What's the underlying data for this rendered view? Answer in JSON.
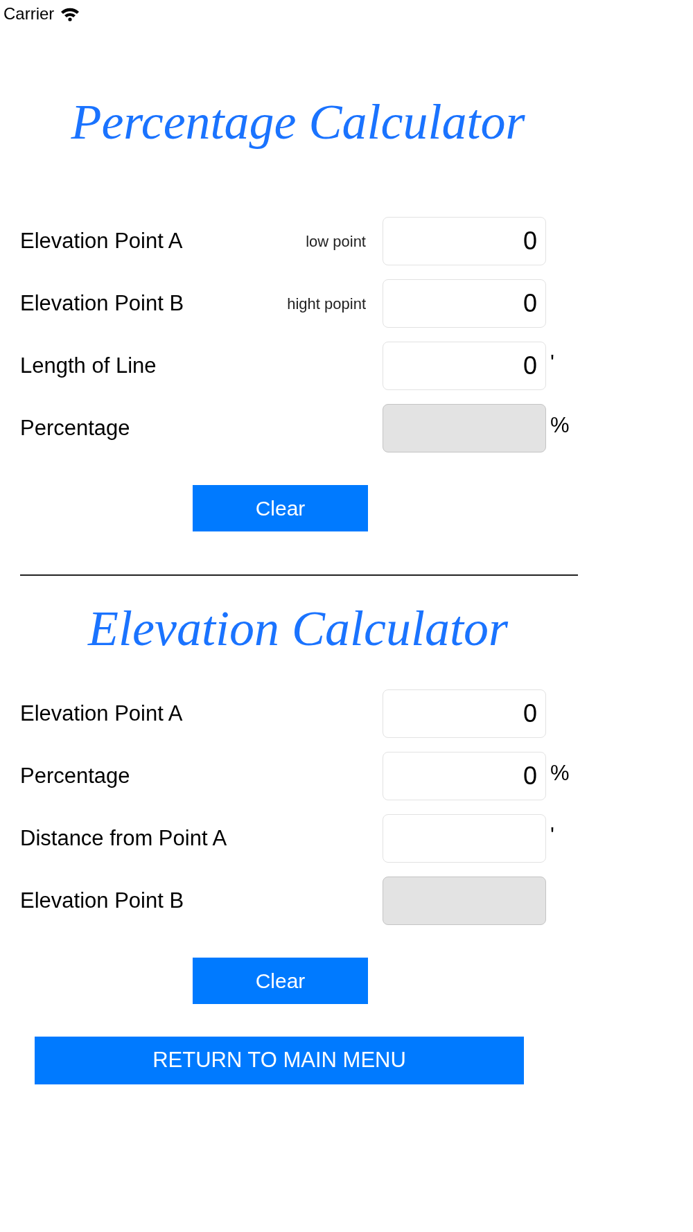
{
  "status_bar": {
    "carrier": "Carrier"
  },
  "sections": [
    {
      "title": "Percentage Calculator",
      "rows": [
        {
          "label": "Elevation Point A",
          "hint": "low point",
          "value": "0",
          "readonly": false
        },
        {
          "label": "Elevation Point B",
          "hint": "hight popint",
          "value": "0",
          "readonly": false
        },
        {
          "label": "Length of Line",
          "value": "0",
          "unit": "'",
          "readonly": false
        },
        {
          "label": "Percentage",
          "unit": "%",
          "readonly": true
        }
      ],
      "button": "Clear"
    },
    {
      "title": "Elevation Calculator",
      "rows": [
        {
          "label": "Elevation Point A",
          "value": "0",
          "readonly": false
        },
        {
          "label": "Percentage",
          "value": "0",
          "unit": "%",
          "readonly": false
        },
        {
          "label": "Distance from Point A",
          "unit": "'",
          "readonly": false
        },
        {
          "label": "Elevation Point B",
          "readonly": true
        }
      ],
      "button": "Clear"
    }
  ],
  "return_button": "RETURN TO MAIN MENU"
}
